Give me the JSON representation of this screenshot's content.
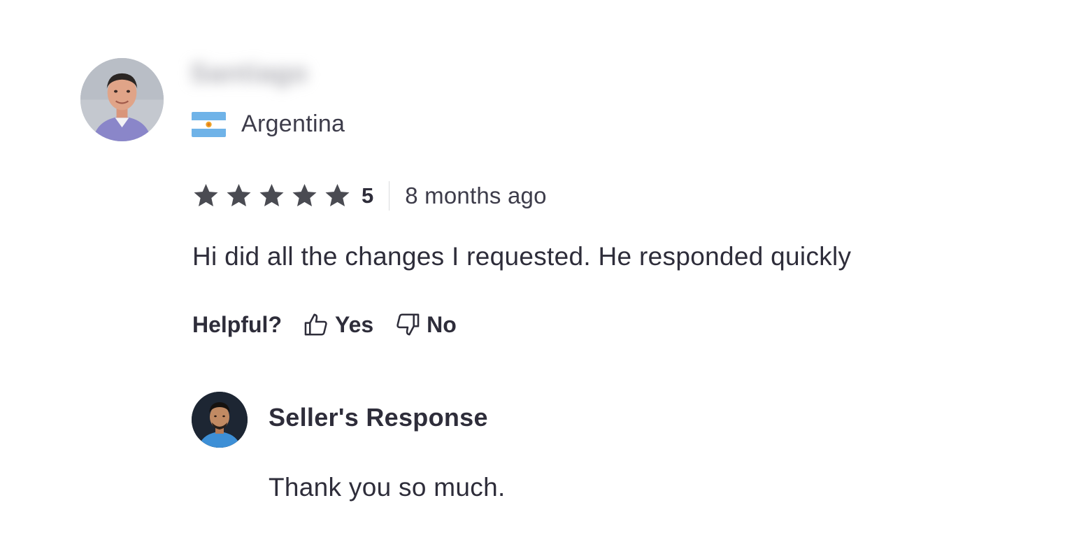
{
  "review": {
    "reviewer": {
      "name": "Santiago",
      "country": "Argentina",
      "flag_icon": "argentina-flag-icon"
    },
    "rating": {
      "stars": 5,
      "max_stars": 5,
      "value_label": "5",
      "star_color": "#4a4b52"
    },
    "time_ago": "8 months ago",
    "text": "Hi did all the changes I requested. He responded quickly",
    "helpful": {
      "label": "Helpful?",
      "yes_label": "Yes",
      "no_label": "No",
      "yes_icon": "thumbs-up-icon",
      "no_icon": "thumbs-down-icon"
    },
    "seller_response": {
      "title": "Seller's Response",
      "text": "Thank you so much."
    }
  }
}
